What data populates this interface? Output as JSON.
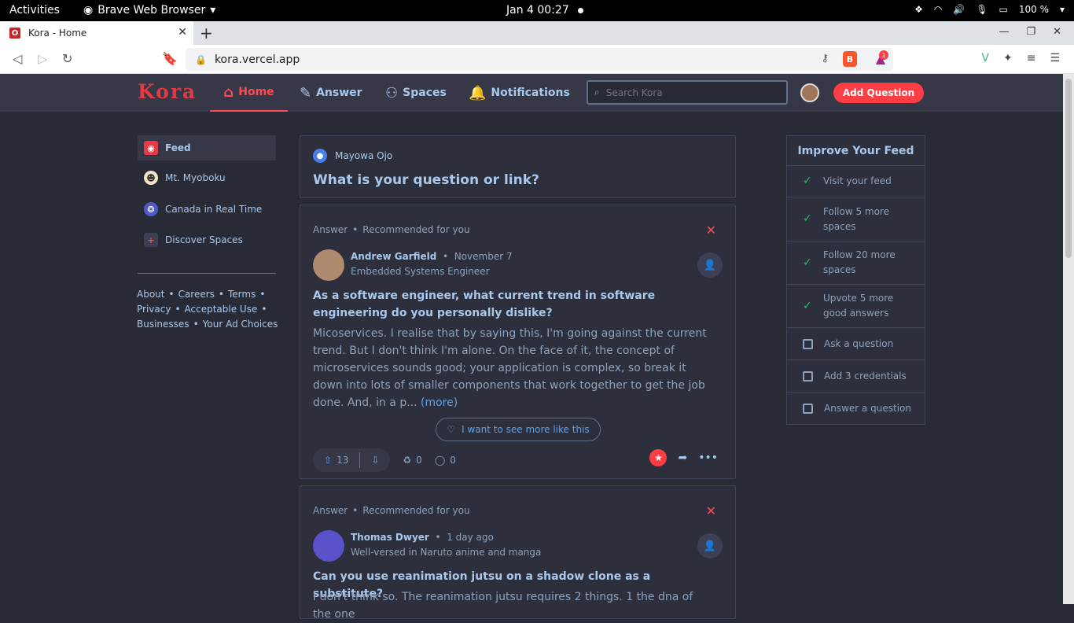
{
  "system_bar": {
    "activities": "Activities",
    "app_name": "Brave Web Browser",
    "clock": "Jan 4  00:27",
    "battery": "100 %"
  },
  "browser": {
    "tab_title": "Kora - Home",
    "url": "kora.vercel.app",
    "notif_count": "1"
  },
  "header": {
    "logo": "Kora",
    "nav": [
      {
        "label": "Home",
        "icon": "home-icon",
        "active": true
      },
      {
        "label": "Answer",
        "icon": "pencil-icon"
      },
      {
        "label": "Spaces",
        "icon": "people-icon"
      },
      {
        "label": "Notifications",
        "icon": "bell-icon"
      }
    ],
    "search_placeholder": "Search Kora",
    "add_question": "Add Question"
  },
  "sidebar": {
    "items": [
      {
        "label": "Feed",
        "icon": "rss-icon",
        "active": true
      },
      {
        "label": "Mt. Myoboku",
        "icon": "space-avatar-icon"
      },
      {
        "label": "Canada in Real Time",
        "icon": "space-emblem-icon"
      },
      {
        "label": "Discover Spaces",
        "icon": "plus-icon"
      }
    ],
    "footer": [
      "About",
      "Careers",
      "Terms",
      "Privacy",
      "Acceptable Use",
      "Businesses",
      "Your Ad Choices"
    ]
  },
  "ask_box": {
    "user": "Mayowa Ojo",
    "prompt": "What is your question or link?"
  },
  "posts": [
    {
      "type": "Answer",
      "reason": "Recommended for you",
      "author": "Andrew Garfield",
      "date": "November 7",
      "credential": "Embedded Systems Engineer",
      "question": "As a software engineer, what current trend in software engineering do you personally dislike?",
      "excerpt": "Micoservices. I realise that by saying this, I'm going against the current trend. But I don't think I'm alone. On the face of it, the concept of microservices sounds good; your application is complex, so break it down into lots of smaller components that work together to get the job done. And, in a p...",
      "more_label": "(more)",
      "more_like": "I want to see more like this",
      "upvotes": "13",
      "shares": "0",
      "comments": "0"
    },
    {
      "type": "Answer",
      "reason": "Recommended for you",
      "author": "Thomas Dwyer",
      "date": "1 day ago",
      "credential": "Well-versed in Naruto anime and manga",
      "question": "Can you use reanimation jutsu on a shadow clone as a substitute?",
      "excerpt": "I don't think so. The reanimation jutsu requires 2 things. 1 the dna of the one"
    }
  ],
  "improve_feed": {
    "title": "Improve Your Feed",
    "items": [
      {
        "label": "Visit your feed",
        "done": true
      },
      {
        "label": "Follow 5 more spaces",
        "done": true
      },
      {
        "label": "Follow 20 more spaces",
        "done": true
      },
      {
        "label": "Upvote 5 more good answers",
        "done": true
      },
      {
        "label": "Ask a question",
        "done": false
      },
      {
        "label": "Add 3 credentials",
        "done": false
      },
      {
        "label": "Answer a question",
        "done": false
      }
    ]
  },
  "colors": {
    "accent": "#ff3d44",
    "link": "#a8c8ec",
    "background": "#282a36",
    "card": "#2d2f3c"
  }
}
